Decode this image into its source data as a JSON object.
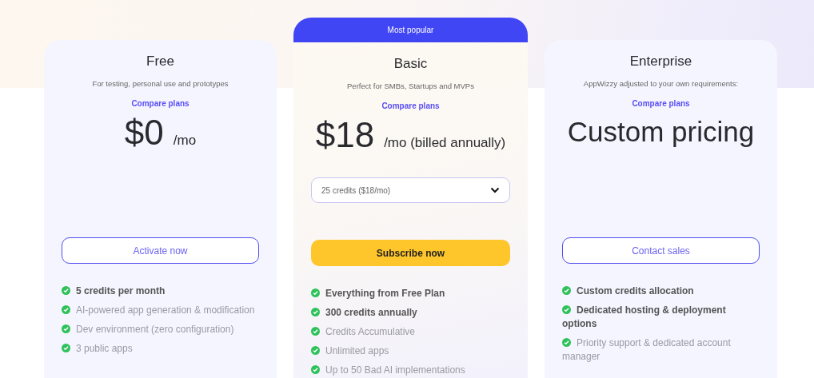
{
  "plans": [
    {
      "name": "Free",
      "description": "For testing, personal use and prototypes",
      "compare_link": "Compare plans",
      "price": {
        "kind": "amount",
        "amount": "$0",
        "period": "/mo"
      },
      "button": {
        "label": "Activate now",
        "kind": "outline"
      },
      "features": [
        {
          "text": "5 credits per month",
          "emphasis": true
        },
        {
          "text": "AI-powered app generation & modification",
          "emphasis": false
        },
        {
          "text": "Dev environment (zero configuration)",
          "emphasis": false
        },
        {
          "text": "3 public apps",
          "emphasis": false
        }
      ]
    },
    {
      "name": "Basic",
      "badge": "Most popular",
      "description": "Perfect for SMBs, Startups and MVPs",
      "compare_link": "Compare plans",
      "price": {
        "kind": "amount",
        "amount": "$18",
        "period": "/mo (billed annually)"
      },
      "dropdown": {
        "value": "25 credits ($18/mo)"
      },
      "button": {
        "label": "Subscribe now",
        "kind": "filled"
      },
      "features": [
        {
          "text": "Everything from Free Plan",
          "emphasis": true
        },
        {
          "text": "300 credits annually",
          "emphasis": true
        },
        {
          "text": "Credits Accumulative",
          "emphasis": false
        },
        {
          "text": "Unlimited apps",
          "emphasis": false
        },
        {
          "text": "Up to 50 Bad AI implementations",
          "emphasis": false
        }
      ]
    },
    {
      "name": "Enterprise",
      "description": "AppWizzy adjusted to your own requirements:",
      "compare_link": "Compare plans",
      "price": {
        "kind": "custom",
        "label": "Custom pricing"
      },
      "button": {
        "label": "Contact sales",
        "kind": "outline"
      },
      "features": [
        {
          "text": "Custom credits allocation",
          "emphasis": true
        },
        {
          "text": "Dedicated hosting & deployment options",
          "emphasis": true
        },
        {
          "text": "Priority support & dedicated account manager",
          "emphasis": false
        }
      ]
    }
  ]
}
